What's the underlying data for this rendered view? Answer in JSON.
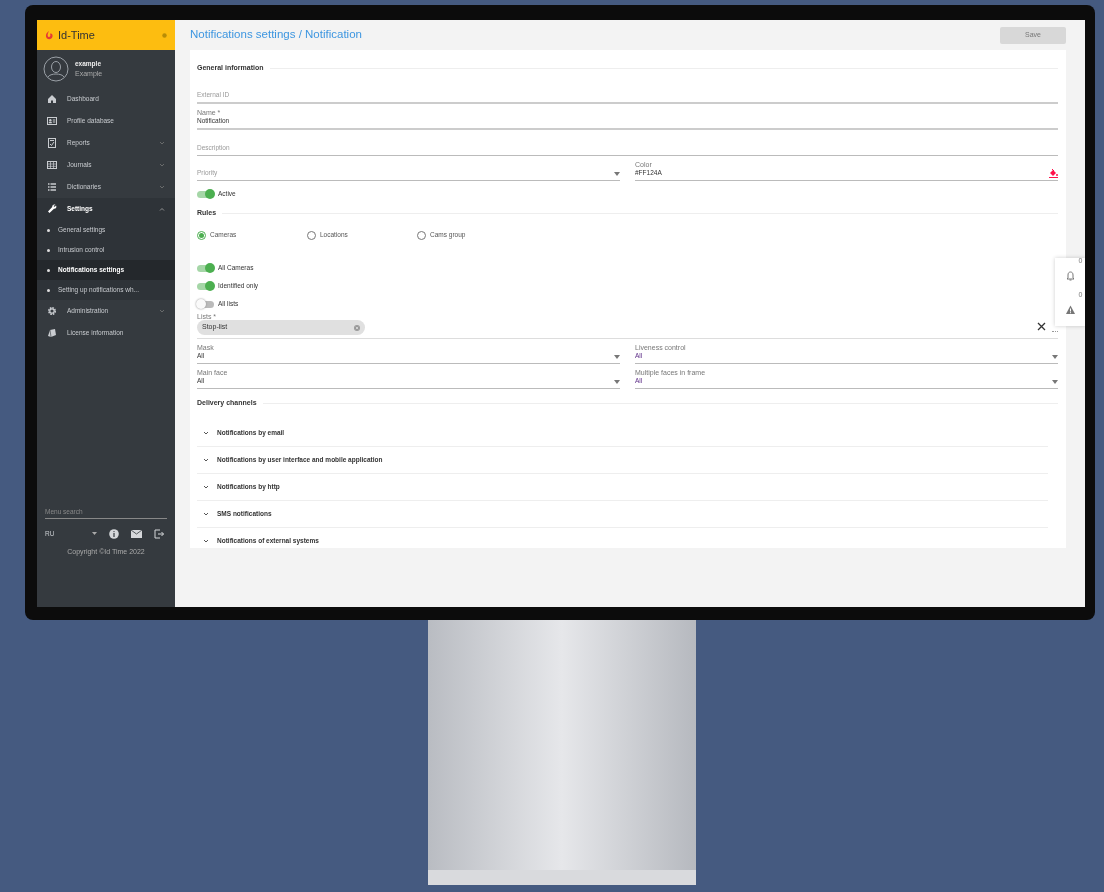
{
  "sidebar": {
    "brand": "Id-Time",
    "user": {
      "name": "example",
      "role": "Example"
    },
    "items": [
      {
        "label": "Dashboard"
      },
      {
        "label": "Profile database"
      },
      {
        "label": "Reports",
        "expanded": false
      },
      {
        "label": "Journals",
        "expanded": false
      },
      {
        "label": "Dictionaries",
        "expanded": false
      },
      {
        "label": "Settings",
        "expanded": true,
        "children": [
          {
            "label": "General settings",
            "selected": false
          },
          {
            "label": "Intrusion control",
            "selected": false
          },
          {
            "label": "Notifications settings",
            "selected": true
          },
          {
            "label": "Setting up notifications wh...",
            "selected": false
          }
        ]
      },
      {
        "label": "Administration",
        "expanded": false
      },
      {
        "label": "License information"
      }
    ],
    "menu_search": {
      "placeholder": "Menu search"
    },
    "language": "RU",
    "copyright": "Copyright ©Id Time 2022"
  },
  "main": {
    "title": "Notifications settings / Notification",
    "save_button": {
      "label": "Save",
      "disabled": true
    },
    "general": {
      "heading": "General information",
      "fields": [
        {
          "placeholder": "External ID"
        },
        {
          "label": "Name *",
          "value": "Notification"
        },
        {
          "placeholder": "Description"
        }
      ],
      "priority": {
        "placeholder": "Priority"
      },
      "color": {
        "label": "Color",
        "value": "#FF124A",
        "color": "#ff124a"
      },
      "active": {
        "label": "Active",
        "on": true
      }
    },
    "rules": {
      "heading": "Rules",
      "sources": [
        {
          "label": "Cameras",
          "selected": true
        },
        {
          "label": "Locations",
          "selected": false
        },
        {
          "label": "Cams group",
          "selected": false
        }
      ],
      "toggles": [
        {
          "label": "All Cameras",
          "on": true
        },
        {
          "label": "Identified only",
          "on": true
        },
        {
          "label": "All lists",
          "on": false
        }
      ],
      "lists": {
        "label": "Lists *",
        "chips": [
          "Stop-list"
        ]
      },
      "selects": [
        {
          "label": "Mask",
          "value": "All"
        },
        {
          "label": "Liveness control",
          "value": "All"
        },
        {
          "label": "Main face",
          "value": "All"
        },
        {
          "label": "Multiple faces in frame",
          "value": "All"
        }
      ]
    },
    "delivery": {
      "heading": "Delivery channels",
      "channels": [
        {
          "label": "Notifications by email",
          "expanded": false
        },
        {
          "label": "Notifications by user interface and mobile application",
          "expanded": false
        },
        {
          "label": "Notifications by http",
          "expanded": false
        },
        {
          "label": "SMS notifications",
          "expanded": false
        },
        {
          "label": "Notifications of external systems",
          "expanded": false
        }
      ]
    }
  },
  "alerts": [
    {
      "count": "0"
    },
    {
      "count": "0"
    }
  ]
}
